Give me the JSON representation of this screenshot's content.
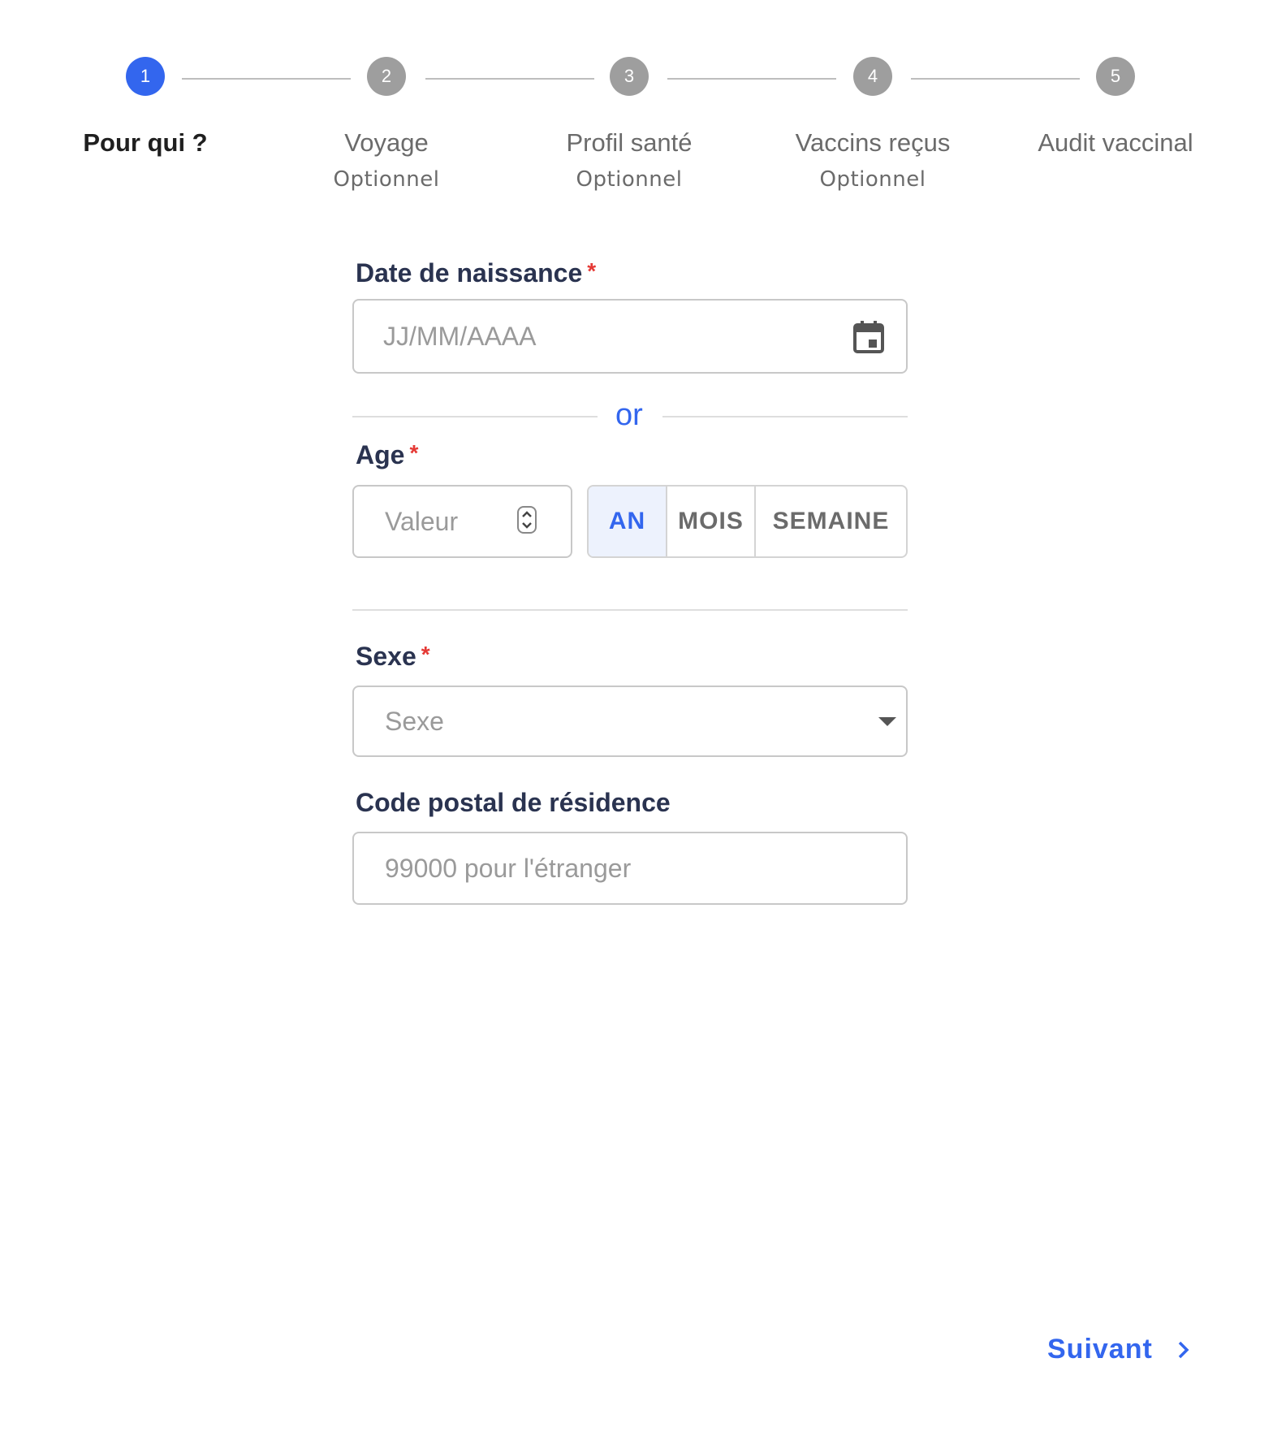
{
  "stepper": {
    "steps": [
      {
        "number": "1",
        "label": "Pour qui ?",
        "sub": "",
        "active": true
      },
      {
        "number": "2",
        "label": "Voyage",
        "sub": "Optionnel",
        "active": false
      },
      {
        "number": "3",
        "label": "Profil santé",
        "sub": "Optionnel",
        "active": false
      },
      {
        "number": "4",
        "label": "Vaccins reçus",
        "sub": "Optionnel",
        "active": false
      },
      {
        "number": "5",
        "label": "Audit vaccinal",
        "sub": "",
        "active": false
      }
    ]
  },
  "form": {
    "birthdate": {
      "label": "Date de naissance",
      "required_mark": "*",
      "placeholder": "JJ/MM/AAAA",
      "icon": "calendar-icon"
    },
    "or_text": "or",
    "age": {
      "label": "Age",
      "required_mark": "*",
      "placeholder": "Valeur",
      "icon": "stepper-icon",
      "units": [
        "AN",
        "MOIS",
        "SEMAINE"
      ],
      "selected_unit": "AN"
    },
    "sexe": {
      "label": "Sexe",
      "required_mark": "*",
      "placeholder": "Sexe",
      "icon": "caret-down-icon"
    },
    "postal": {
      "label": "Code postal de résidence",
      "placeholder": "99000 pour l'étranger"
    }
  },
  "footer": {
    "next_label": "Suivant",
    "next_icon": "chevron-right-icon"
  },
  "colors": {
    "accent": "#3366ee",
    "required": "#e53935",
    "inactive_step": "#9e9e9e",
    "label": "#2a3350"
  }
}
